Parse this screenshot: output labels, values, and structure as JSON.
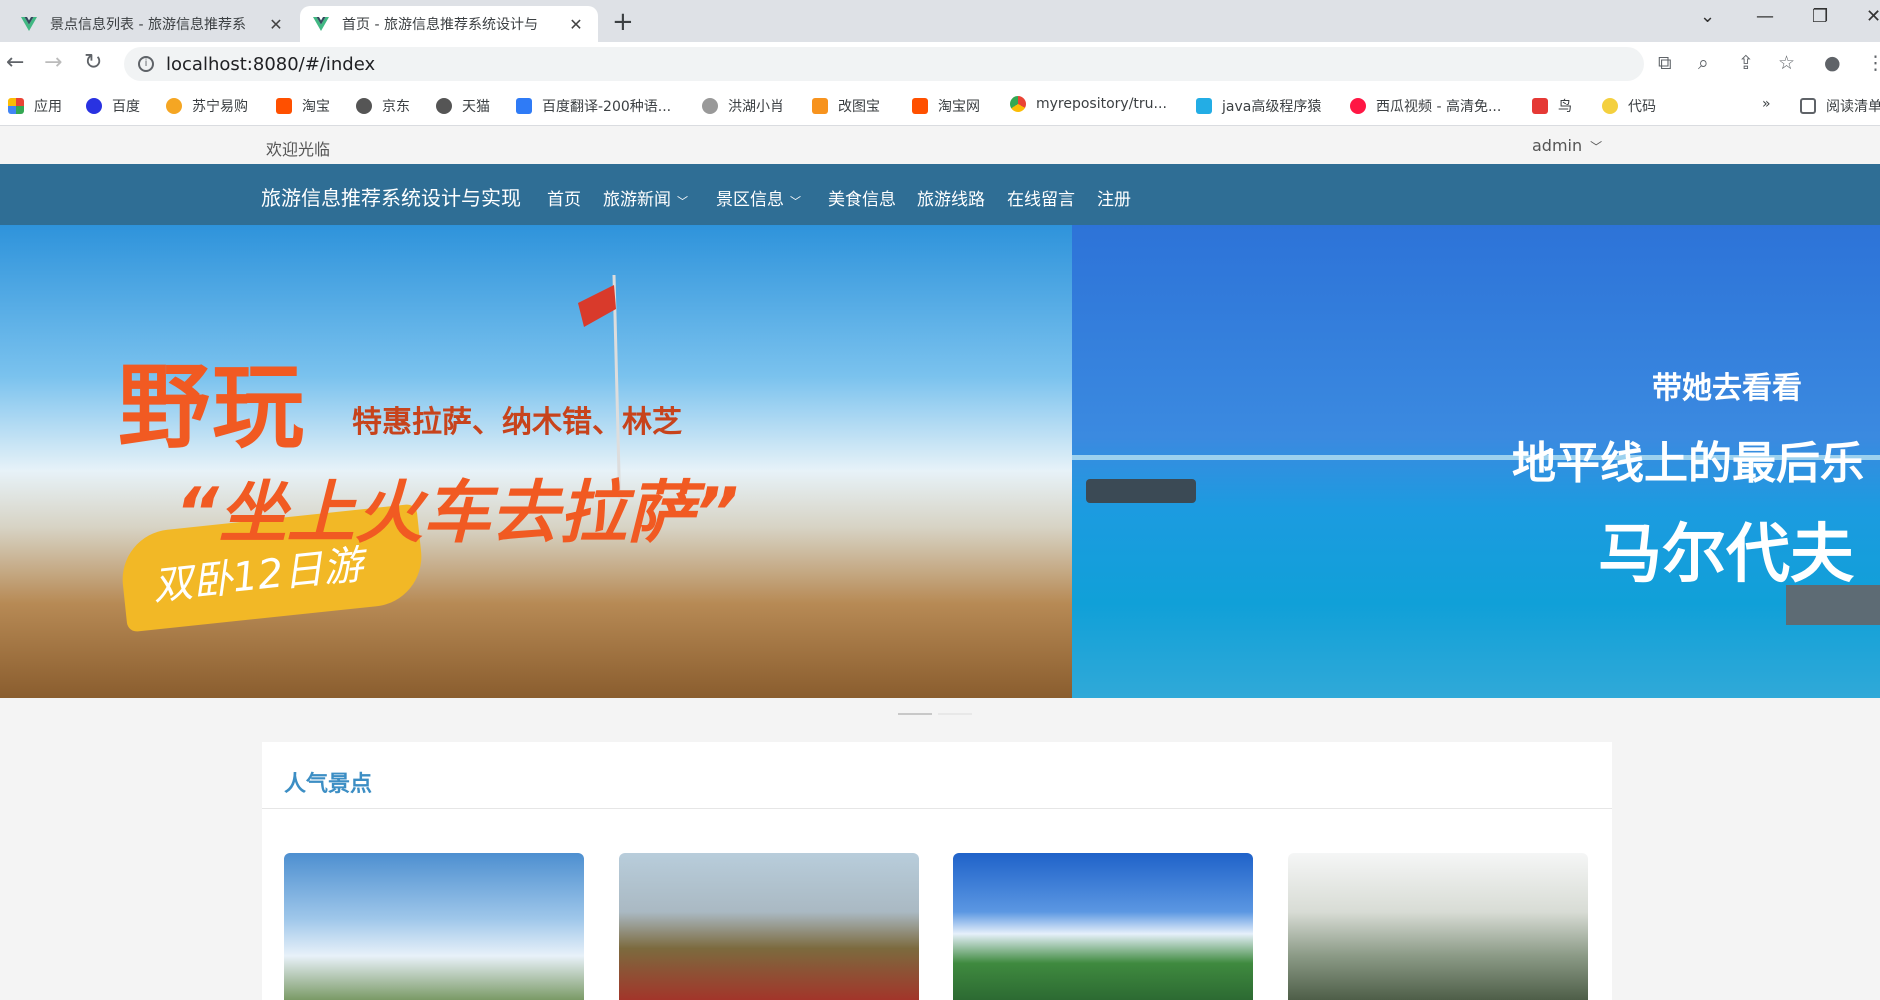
{
  "browser": {
    "tabs": [
      {
        "title": "景点信息列表 - 旅游信息推荐系",
        "active": false
      },
      {
        "title": "首页 - 旅游信息推荐系统设计与",
        "active": true
      }
    ],
    "new_tab": "+",
    "url": "localhost:8080/#/index",
    "bookmarks": [
      {
        "label": "应用",
        "icon": "apps-grid-icon",
        "color": "#e8453c"
      },
      {
        "label": "百度",
        "icon": "baidu-paw-icon",
        "color": "#2932e1"
      },
      {
        "label": "苏宁易购",
        "icon": "suning-icon",
        "color": "#f5a623"
      },
      {
        "label": "淘宝",
        "icon": "taobao-icon",
        "color": "#ff5000"
      },
      {
        "label": "京东",
        "icon": "globe-icon",
        "color": "#555555"
      },
      {
        "label": "天猫",
        "icon": "globe-icon",
        "color": "#555555"
      },
      {
        "label": "百度翻译-200种语...",
        "icon": "translate-icon",
        "color": "#2f7bf6"
      },
      {
        "label": "洪湖小肖",
        "icon": "feather-icon",
        "color": "#888888"
      },
      {
        "label": "改图宝",
        "icon": "gaitubao-icon",
        "color": "#f7931e"
      },
      {
        "label": "淘宝网",
        "icon": "taobao-icon",
        "color": "#ff5000"
      },
      {
        "label": "myrepository/tru...",
        "icon": "chrome-icon",
        "color": "#34a853"
      },
      {
        "label": "java高级程序猿",
        "icon": "bilibili-icon",
        "color": "#23ade5"
      },
      {
        "label": "西瓜视频 - 高清免...",
        "icon": "xigua-icon",
        "color": "#ff1744"
      },
      {
        "label": "鸟",
        "icon": "bird-icon",
        "color": "#e53935"
      },
      {
        "label": "代码",
        "icon": "moon-icon",
        "color": "#f4d03f"
      }
    ],
    "more_bookmarks": "»",
    "reading_list": "阅读清单"
  },
  "site": {
    "welcome": "欢迎光临",
    "user": "admin",
    "brand": "旅游信息推荐系统设计与实现",
    "nav": [
      {
        "label": "首页",
        "dropdown": false
      },
      {
        "label": "旅游新闻",
        "dropdown": true
      },
      {
        "label": "景区信息",
        "dropdown": true
      },
      {
        "label": "美食信息",
        "dropdown": false
      },
      {
        "label": "旅游线路",
        "dropdown": false
      },
      {
        "label": "在线留言",
        "dropdown": false
      },
      {
        "label": "注册",
        "dropdown": false
      }
    ],
    "banner1": {
      "big": "野玩",
      "sub": "特惠拉萨、纳木错、林芝",
      "train": "“坐上火车去拉萨”",
      "tag": "双卧12日游"
    },
    "banner2": {
      "line1": "带她去看看",
      "line2": "地平线上的最后乐",
      "line3": "马尔代夫"
    },
    "section_title": "人气景点"
  },
  "colors": {
    "nav_bg": "#2f6e95",
    "section_title": "#3c8ec4",
    "page_bg": "#f4f4f4"
  }
}
